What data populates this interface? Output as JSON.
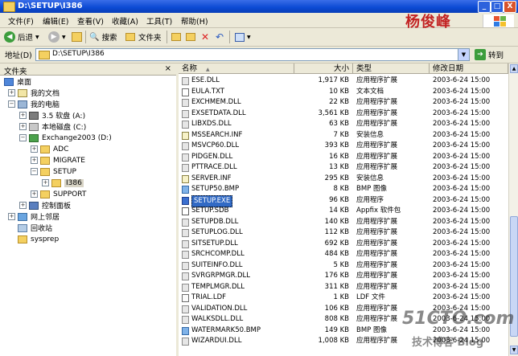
{
  "window": {
    "title": "D:\\SETUP\\I386",
    "watermark_name": "杨俊峰",
    "controls": {
      "minimize": "_",
      "maximize": "□",
      "close": "X"
    }
  },
  "menu": [
    {
      "label": "文件(F)"
    },
    {
      "label": "编辑(E)"
    },
    {
      "label": "查看(V)"
    },
    {
      "label": "收藏(A)"
    },
    {
      "label": "工具(T)"
    },
    {
      "label": "帮助(H)"
    }
  ],
  "toolbar": {
    "back": "后退",
    "search": "搜索",
    "folders": "文件夹"
  },
  "address": {
    "label": "地址(D)",
    "value": "D:\\SETUP\\I386",
    "go": "转到"
  },
  "folder_pane": {
    "title": "文件夹",
    "close": "×",
    "tree": [
      {
        "label": "桌面",
        "icon": "desktop-icon"
      },
      {
        "label": "我的文档",
        "icon": "my-documents-icon",
        "toggle": "+"
      },
      {
        "label": "我的电脑",
        "icon": "my-computer-icon",
        "toggle": "−"
      },
      {
        "label": "3.5 软盘 (A:)",
        "icon": "floppy-icon",
        "toggle": "+"
      },
      {
        "label": "本地磁盘 (C:)",
        "icon": "drive-icon",
        "toggle": "+"
      },
      {
        "label": "Exchange2003 (D:)",
        "icon": "exchange-drive-icon",
        "toggle": "−"
      },
      {
        "label": "ADC",
        "icon": "folder-icon",
        "toggle": "+"
      },
      {
        "label": "MIGRATE",
        "icon": "folder-icon",
        "toggle": "+"
      },
      {
        "label": "SETUP",
        "icon": "folder-icon",
        "toggle": "−"
      },
      {
        "label": "I386",
        "icon": "folder-icon",
        "toggle": "+"
      },
      {
        "label": "SUPPORT",
        "icon": "folder-icon",
        "toggle": "+"
      },
      {
        "label": "控制面板",
        "icon": "control-panel-icon",
        "toggle": "+"
      },
      {
        "label": "网上邻居",
        "icon": "network-icon",
        "toggle": "+"
      },
      {
        "label": "回收站",
        "icon": "recycle-bin-icon"
      },
      {
        "label": "sysprep",
        "icon": "folder-icon"
      }
    ]
  },
  "columns": {
    "name": "名称",
    "size": "大小",
    "type": "类型",
    "date": "修改日期",
    "sort_arrow": "▲"
  },
  "files": [
    {
      "name": "ESE.DLL",
      "size": "1,917 KB",
      "type": "应用程序扩展",
      "date": "2003-6-24 15:00",
      "kind": "dll"
    },
    {
      "name": "EULA.TXT",
      "size": "10 KB",
      "type": "文本文档",
      "date": "2003-6-24 15:00",
      "kind": "txt"
    },
    {
      "name": "EXCHMEM.DLL",
      "size": "22 KB",
      "type": "应用程序扩展",
      "date": "2003-6-24 15:00",
      "kind": "dll"
    },
    {
      "name": "EXSETDATA.DLL",
      "size": "3,561 KB",
      "type": "应用程序扩展",
      "date": "2003-6-24 15:00",
      "kind": "dll"
    },
    {
      "name": "LIBXDS.DLL",
      "size": "63 KB",
      "type": "应用程序扩展",
      "date": "2003-6-24 15:00",
      "kind": "dll"
    },
    {
      "name": "MSSEARCH.INF",
      "size": "7 KB",
      "type": "安装信息",
      "date": "2003-6-24 15:00",
      "kind": "inf"
    },
    {
      "name": "MSVCP60.DLL",
      "size": "393 KB",
      "type": "应用程序扩展",
      "date": "2003-6-24 15:00",
      "kind": "dll"
    },
    {
      "name": "PIDGEN.DLL",
      "size": "16 KB",
      "type": "应用程序扩展",
      "date": "2003-6-24 15:00",
      "kind": "dll"
    },
    {
      "name": "PTTRACE.DLL",
      "size": "13 KB",
      "type": "应用程序扩展",
      "date": "2003-6-24 15:00",
      "kind": "dll"
    },
    {
      "name": "SERVER.INF",
      "size": "295 KB",
      "type": "安装信息",
      "date": "2003-6-24 15:00",
      "kind": "inf"
    },
    {
      "name": "SETUP50.BMP",
      "size": "8 KB",
      "type": "BMP 图像",
      "date": "2003-6-24 15:00",
      "kind": "bmp"
    },
    {
      "name": "SETUP.EXE",
      "size": "96 KB",
      "type": "应用程序",
      "date": "2003-6-24 15:00",
      "kind": "exe",
      "selected": true
    },
    {
      "name": "SETUP.SDB",
      "size": "14 KB",
      "type": "Appfix 软件包",
      "date": "2003-6-24 15:00",
      "kind": "sdb"
    },
    {
      "name": "SETUPDB.DLL",
      "size": "140 KB",
      "type": "应用程序扩展",
      "date": "2003-6-24 15:00",
      "kind": "dll"
    },
    {
      "name": "SETUPLOG.DLL",
      "size": "112 KB",
      "type": "应用程序扩展",
      "date": "2003-6-24 15:00",
      "kind": "dll"
    },
    {
      "name": "SITSETUP.DLL",
      "size": "692 KB",
      "type": "应用程序扩展",
      "date": "2003-6-24 15:00",
      "kind": "dll"
    },
    {
      "name": "SRCHCOMP.DLL",
      "size": "484 KB",
      "type": "应用程序扩展",
      "date": "2003-6-24 15:00",
      "kind": "dll"
    },
    {
      "name": "SUITEINFO.DLL",
      "size": "5 KB",
      "type": "应用程序扩展",
      "date": "2003-6-24 15:00",
      "kind": "dll"
    },
    {
      "name": "SVRGRPMGR.DLL",
      "size": "176 KB",
      "type": "应用程序扩展",
      "date": "2003-6-24 15:00",
      "kind": "dll"
    },
    {
      "name": "TEMPLMGR.DLL",
      "size": "311 KB",
      "type": "应用程序扩展",
      "date": "2003-6-24 15:00",
      "kind": "dll"
    },
    {
      "name": "TRIAL.LDF",
      "size": "1 KB",
      "type": "LDF 文件",
      "date": "2003-6-24 15:00",
      "kind": "ldf"
    },
    {
      "name": "VALIDATION.DLL",
      "size": "106 KB",
      "type": "应用程序扩展",
      "date": "2003-6-24 15:00",
      "kind": "dll"
    },
    {
      "name": "WALKSDLL.DLL",
      "size": "808 KB",
      "type": "应用程序扩展",
      "date": "2003-6-24 15:00",
      "kind": "dll"
    },
    {
      "name": "WATERMARK50.BMP",
      "size": "149 KB",
      "type": "BMP 图像",
      "date": "2003-6-24 15:00",
      "kind": "bmp"
    },
    {
      "name": "WIZARDUI.DLL",
      "size": "1,008 KB",
      "type": "应用程序扩展",
      "date": "2003-6-24 15:00",
      "kind": "dll"
    }
  ],
  "watermark": {
    "site": "51CTO.com",
    "blog": "技术博客  Blog"
  },
  "colors": {
    "title_bar": "#0b49d3",
    "selection": "#316ac5",
    "chrome": "#ece9d8",
    "go_green": "#3c9d3c"
  }
}
